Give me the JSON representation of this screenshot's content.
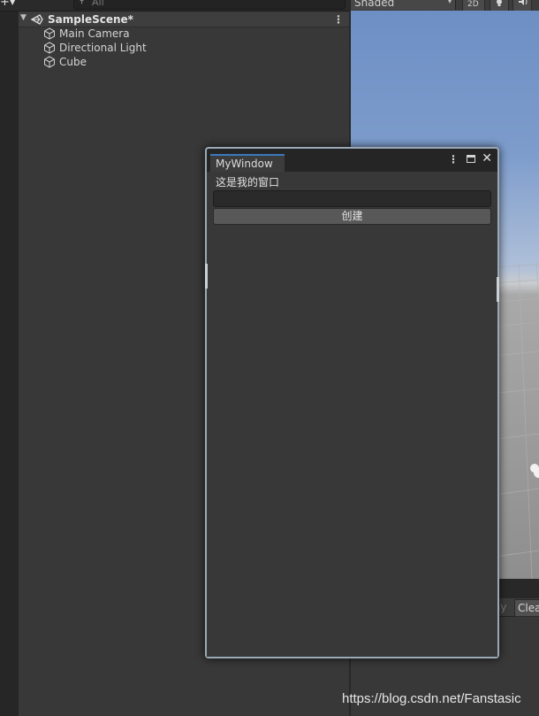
{
  "hierarchy": {
    "add_label": "+▾",
    "search_icon": "⚲",
    "search_placeholder": "All",
    "scene": {
      "fold": "▼",
      "name": "SampleScene*",
      "menu": "⋮"
    },
    "items": [
      {
        "label": "Main Camera"
      },
      {
        "label": "Directional Light"
      },
      {
        "label": "Cube"
      }
    ]
  },
  "scene_toolbar": {
    "shading_mode": "Shaded",
    "dropdown_arrow": "▾",
    "toggle_2d": "2D"
  },
  "console": {
    "pause_label": "ay",
    "clear_label": "Clea"
  },
  "window": {
    "tab_title": "MyWindow",
    "menu_icon": "⋮",
    "close_icon": "✕",
    "label": "这是我的窗口",
    "input_value": "",
    "button_label": "创建"
  },
  "watermark": "https://blog.csdn.net/Fanstasic",
  "colors": {
    "panel_bg": "#383838",
    "accent_tab": "#3a79bb",
    "window_border": "#9aa9b5"
  }
}
